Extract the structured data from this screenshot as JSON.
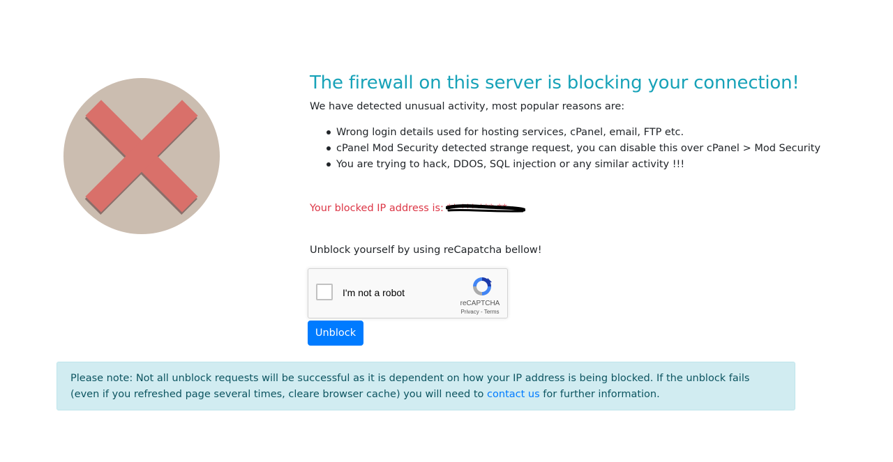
{
  "heading": "The firewall on this server is blocking your connection!",
  "intro": "We have detected unusual activity, most popular reasons are:",
  "reasons": [
    "Wrong login details used for hosting services, cPanel, email, FTP etc.",
    "cPanel Mod Security detected strange request, you can disable this over cPanel > Mod Security",
    "You are trying to hack, DDOS, SQL injection or any similar activity !!!"
  ],
  "ip": {
    "label": "Your blocked IP address is:",
    "value": "**.***.***.**"
  },
  "unblock_prompt": "Unblock yourself by using reCapatcha bellow!",
  "recaptcha": {
    "label": "I'm not a robot",
    "brand": "reCAPTCHA",
    "privacy": "Privacy",
    "separator": " - ",
    "terms": "Terms",
    "checked": false
  },
  "unblock_button": "Unblock",
  "notice": {
    "text_before": "Please note: Not all unblock requests will be successful as it is dependent on how your IP address is being blocked. If the unblock fails (even if you refreshed page several times, cleare browser cache) you will need to ",
    "link": "contact us",
    "text_after": " for further information."
  },
  "colors": {
    "heading": "#17a2b8",
    "ip_text": "#dc3545",
    "button": "#007bff",
    "alert_bg": "#d1ecf1",
    "alert_text": "#0c5460",
    "icon_circle": "#cbbdb0",
    "icon_x": "#d9706a"
  }
}
